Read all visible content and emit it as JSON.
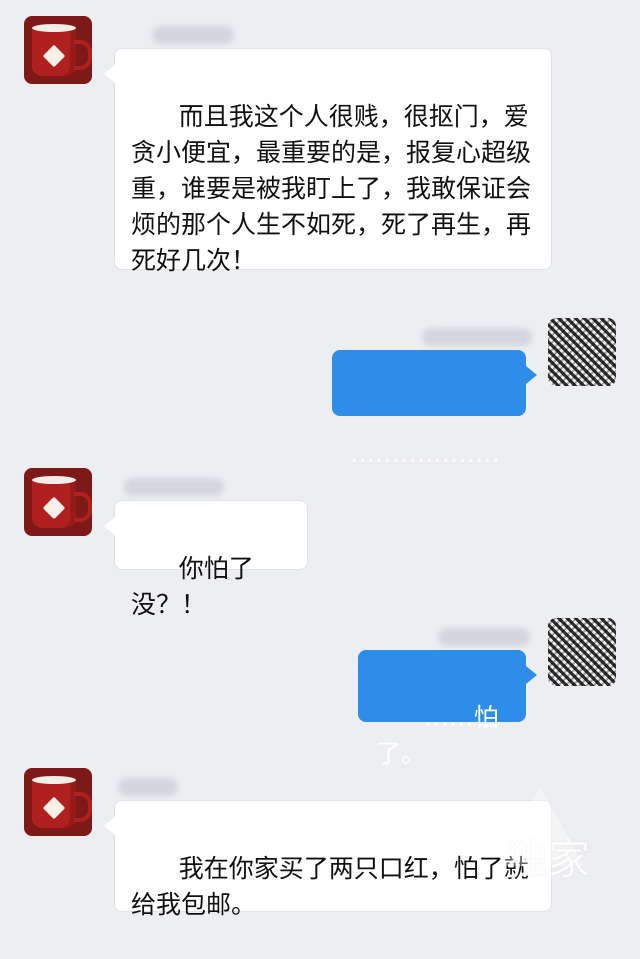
{
  "messages": [
    {
      "side": "left",
      "text": "而且我这个人很贱，很抠门，爱贪小便宜，最重要的是，报复心超级重，谁要是被我盯上了，我敢保证会烦的那个人生不如死，死了再生，再死好几次！"
    },
    {
      "side": "right",
      "text": "………………"
    },
    {
      "side": "left",
      "text": "你怕了没？！"
    },
    {
      "side": "right",
      "text": "……怕了。"
    },
    {
      "side": "left",
      "text": "我在你家买了两只口红，怕了就给我包邮。"
    }
  ],
  "watermark": {
    "text": "独家"
  },
  "icons": {
    "left_avatar": "mug-avatar-icon",
    "right_avatar": "pattern-avatar-icon"
  },
  "colors": {
    "page_background": "#eceef2",
    "left_bubble": "#ffffff",
    "right_bubble": "#2e8de8",
    "text_dark": "#111111",
    "text_light": "#ffffff"
  }
}
